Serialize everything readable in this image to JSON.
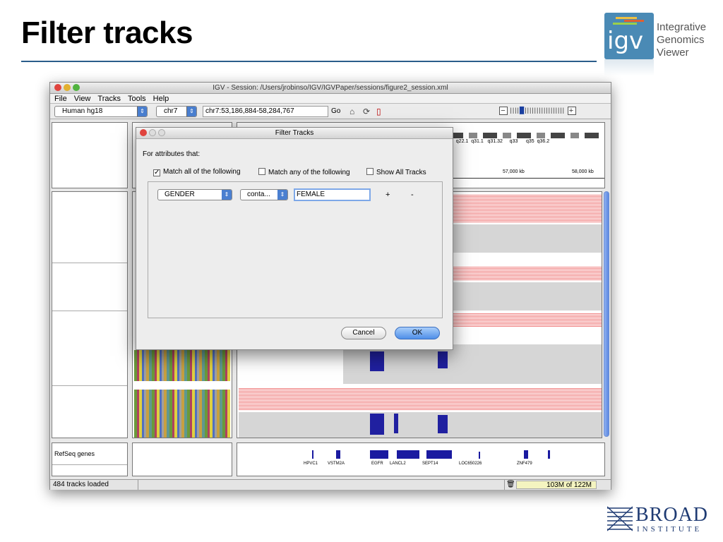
{
  "slide": {
    "title": "Filter tracks"
  },
  "logo": {
    "mark": "igv",
    "line1": "Integrative",
    "line2": "Genomics",
    "line3": "Viewer"
  },
  "broad": {
    "line1": "BROAD",
    "line2": "INSTITUTE"
  },
  "window": {
    "title": "IGV - Session: /Users/jrobinso/IGV/IGVPaper/sessions/figure2_session.xml",
    "menus": [
      "File",
      "View",
      "Tracks",
      "Tools",
      "Help"
    ],
    "genome": "Human hg18",
    "chromosome": "chr7",
    "locus": "chr7:53,186,884-58,284,767",
    "go_label": "Go"
  },
  "ideogram": {
    "bands": "2  q22.1  q31.1   q31.32     q33      q35  q36.2",
    "ruler_left": "57,000 kb",
    "ruler_right": "58,000 kb"
  },
  "refseq": {
    "label": "RefSeq genes",
    "genes": [
      "HPVC1",
      "VSTM2A",
      "EGFR",
      "LANCL2",
      "SEPT14",
      "LOC650226",
      "ZNF479"
    ]
  },
  "status": {
    "tracks_loaded": "484 tracks loaded",
    "memory": "103M of 122M"
  },
  "dialog": {
    "title": "Filter Tracks",
    "for_label": "For attributes that:",
    "match_all": "Match all of the following",
    "match_any": "Match any of the following",
    "show_all": "Show All Tracks",
    "match_all_checked": true,
    "attribute": "GENDER",
    "operator": "conta...",
    "value": "FEMALE",
    "plus": "+",
    "minus": "-",
    "cancel": "Cancel",
    "ok": "OK"
  },
  "colors": {
    "accent": "#4a8ab5",
    "red_track": "#f08080",
    "ok_blue": "#5b9cf0"
  }
}
